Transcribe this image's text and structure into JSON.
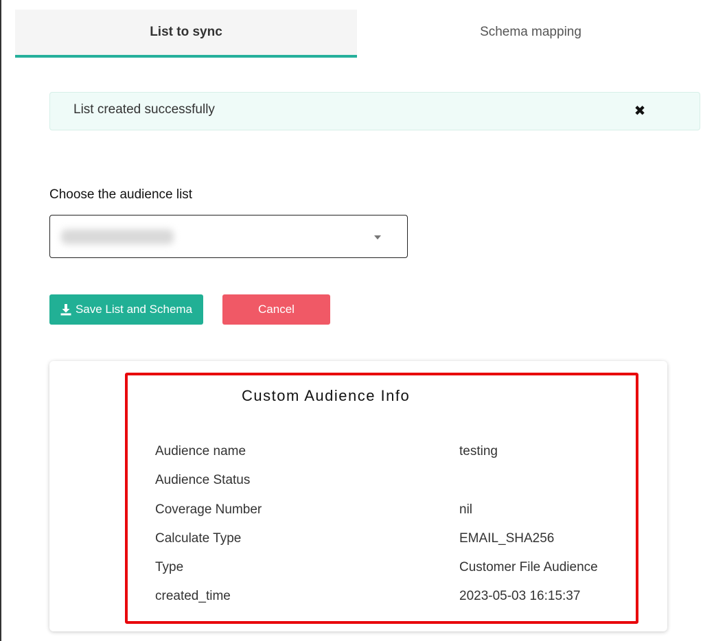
{
  "tabs": [
    {
      "label": "List to sync",
      "active": true
    },
    {
      "label": "Schema mapping",
      "active": false
    }
  ],
  "alert": {
    "message": "List created successfully",
    "close_glyph": "✖",
    "background": "#effbf8"
  },
  "audience_select": {
    "label": "Choose the audience list",
    "selected_value_state": "blurred/redacted"
  },
  "buttons": {
    "save_label": "Save List and Schema",
    "save_icon": "download-icon",
    "save_color": "#21b095",
    "cancel_label": "Cancel",
    "cancel_color": "#f05966"
  },
  "info_card": {
    "title": "Custom Audience Info",
    "highlight_color": "#e8060c",
    "rows": [
      {
        "key": "Audience name",
        "value": "testing"
      },
      {
        "key": "Audience Status",
        "value": ""
      },
      {
        "key": "Coverage Number",
        "value": "nil"
      },
      {
        "key": "Calculate Type",
        "value": "EMAIL_SHA256"
      },
      {
        "key": "Type",
        "value": "Customer File Audience"
      },
      {
        "key": "created_time",
        "value": "2023-05-03 16:15:37"
      }
    ]
  },
  "accent_color": "#26b09b"
}
